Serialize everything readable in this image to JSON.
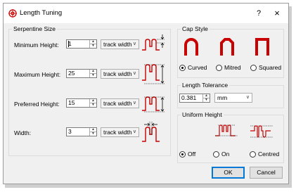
{
  "window": {
    "title": "Length Tuning",
    "help_label": "?",
    "close_label": "×"
  },
  "serpentine": {
    "title": "Serpentine Size",
    "rows": [
      {
        "label": "Minimum Height:",
        "value": "1",
        "unit": "track width"
      },
      {
        "label": "Maximum Height:",
        "value": "25",
        "unit": "track width"
      },
      {
        "label": "Preferred Height:",
        "value": "15",
        "unit": "track width"
      },
      {
        "label": "Width:",
        "value": "3",
        "unit": "track width"
      }
    ]
  },
  "cap_style": {
    "title": "Cap Style",
    "options": [
      {
        "label": "Curved",
        "selected": true
      },
      {
        "label": "Mitred",
        "selected": false
      },
      {
        "label": "Squared",
        "selected": false
      }
    ]
  },
  "length_tolerance": {
    "title": "Length Tolerance",
    "value": "0.381",
    "unit": "mm"
  },
  "uniform_height": {
    "title": "Uniform Height",
    "options": [
      {
        "label": "Off",
        "selected": true
      },
      {
        "label": "On",
        "selected": false
      },
      {
        "label": "Centred",
        "selected": false
      }
    ]
  },
  "buttons": {
    "ok": "OK",
    "cancel": "Cancel"
  },
  "colors": {
    "accent": "#0078d7",
    "diagram_red": "#c80000"
  }
}
